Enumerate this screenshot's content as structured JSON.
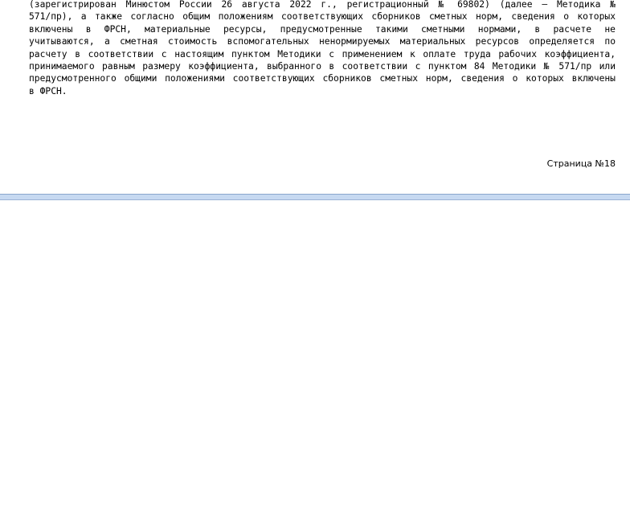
{
  "document": {
    "lines": [
      "(зарегистрирован Минюстом России 26 августа 2022 г., регистрационный № 69802) (далее – Методика №",
      "571/пр), а также согласно общим положениям соответствующих сборников сметных норм, сведения о которых",
      "включены в ФРСН, материальные ресурсы, предусмотренные такими сметными нормами, в расчете не",
      "учитываются, а сметная стоимость вспомогательных ненормируемых материальных ресурсов определяется по",
      "расчету в соответствии с настоящим пунктом Методики с применением к оплате труда рабочих коэффициента,",
      "принимаемого равным размеру коэффициента, выбранного в соответствии с пунктом 84 Методики № 571/пр или",
      "предусмотренного общими положениями соответствующих сборников сметных норм, сведения о которых включены",
      "в ФРСН."
    ],
    "page_number": "Страница №18"
  },
  "colors": {
    "separator": "#c6d9f1",
    "text": "#000000",
    "background": "#ffffff"
  }
}
